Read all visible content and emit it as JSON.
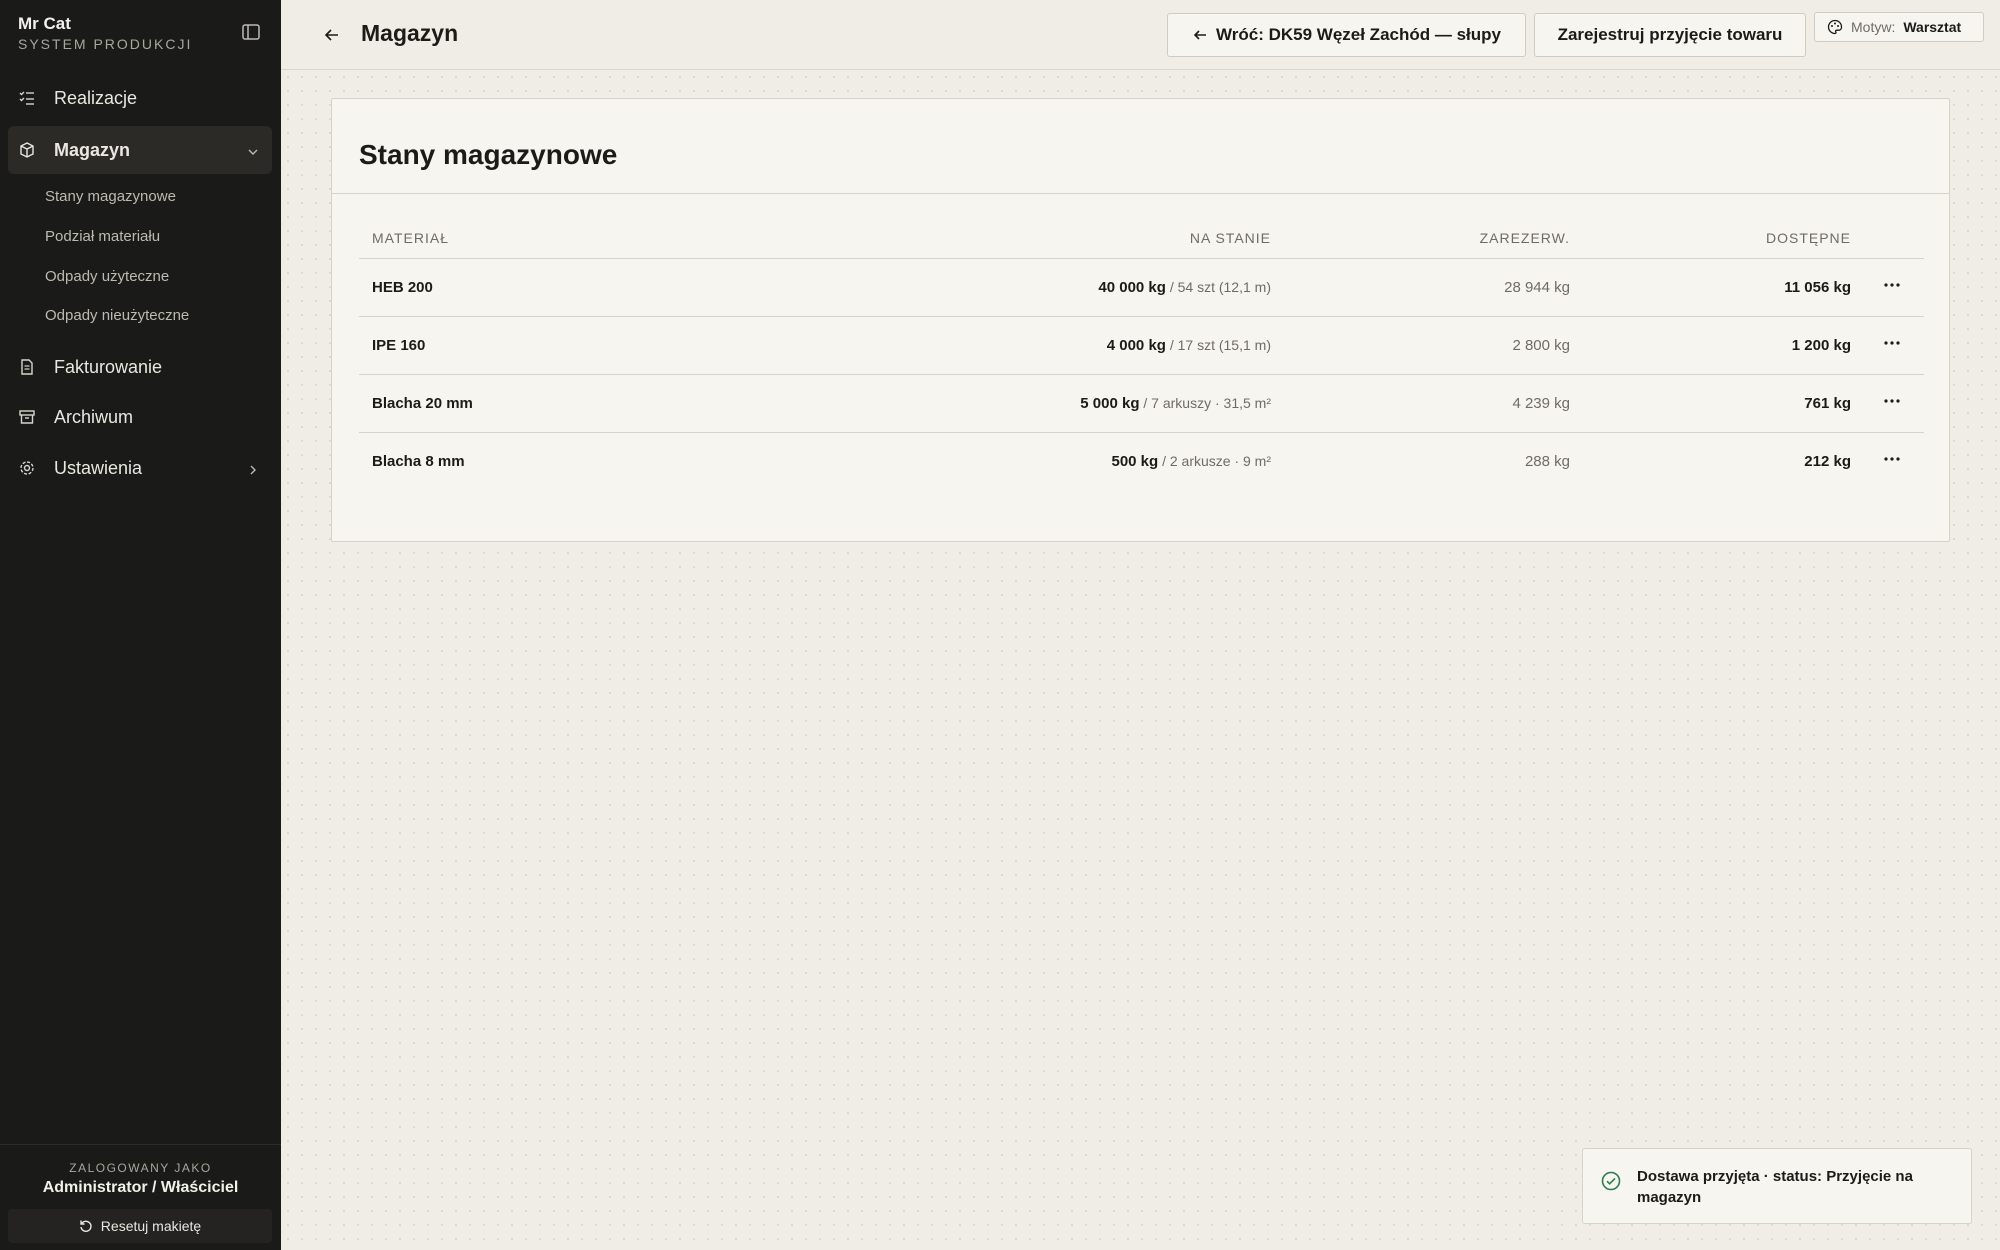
{
  "brand": {
    "name": "Mr Cat",
    "subtitle": "SYSTEM PRODUKCJI"
  },
  "sidebar": {
    "items": [
      {
        "label": "Realizacje",
        "icon": "list-check-icon"
      },
      {
        "label": "Magazyn",
        "icon": "box-icon",
        "active": true,
        "expanded": true
      },
      {
        "label": "Fakturowanie",
        "icon": "file-invoice-icon"
      },
      {
        "label": "Archiwum",
        "icon": "archive-icon"
      },
      {
        "label": "Ustawienia",
        "icon": "gear-icon"
      }
    ],
    "subitems": [
      {
        "label": "Stany magazynowe"
      },
      {
        "label": "Podział materiału"
      },
      {
        "label": "Odpady użyteczne"
      },
      {
        "label": "Odpady nieużyteczne"
      }
    ],
    "footer": {
      "label": "ZALOGOWANY JAKO",
      "user": "Administrator / Właściciel",
      "reset_label": "Resetuj makietę"
    }
  },
  "header": {
    "title": "Magazyn",
    "back_project_label": "Wróć: DK59 Węzeł Zachód — słupy",
    "register_label": "Zarejestruj przyjęcie towaru",
    "theme_key": "Motyw:",
    "theme_value": "Warsztat"
  },
  "card": {
    "title": "Stany magazynowe",
    "columns": [
      "MATERIAŁ",
      "NA STANIE",
      "ZAREZERW.",
      "DOSTĘPNE"
    ],
    "rows": [
      {
        "material": "HEB 200",
        "stock": "40 000 kg",
        "stock_detail": " / 54 szt (12,1 m)",
        "reserved": "28 944 kg",
        "available": "11 056 kg"
      },
      {
        "material": "IPE 160",
        "stock": "4 000 kg",
        "stock_detail": " / 17 szt (15,1 m)",
        "reserved": "2 800 kg",
        "available": "1 200 kg"
      },
      {
        "material": "Blacha 20 mm",
        "stock": "5 000 kg",
        "stock_detail": " / 7 arkuszy · 31,5 m²",
        "reserved": "4 239 kg",
        "available": "761 kg"
      },
      {
        "material": "Blacha 8 mm",
        "stock": "500 kg",
        "stock_detail": " / 2 arkusze · 9 m²",
        "reserved": "288 kg",
        "available": "212 kg"
      }
    ]
  },
  "toast": {
    "text": "Dostawa przyjęta · status: Przyjęcie na magazyn"
  },
  "colors": {
    "sidebar_bg": "#1a1a18",
    "page_bg": "#efede6",
    "card_bg": "#f6f5f0",
    "success": "#2f7d4a"
  }
}
